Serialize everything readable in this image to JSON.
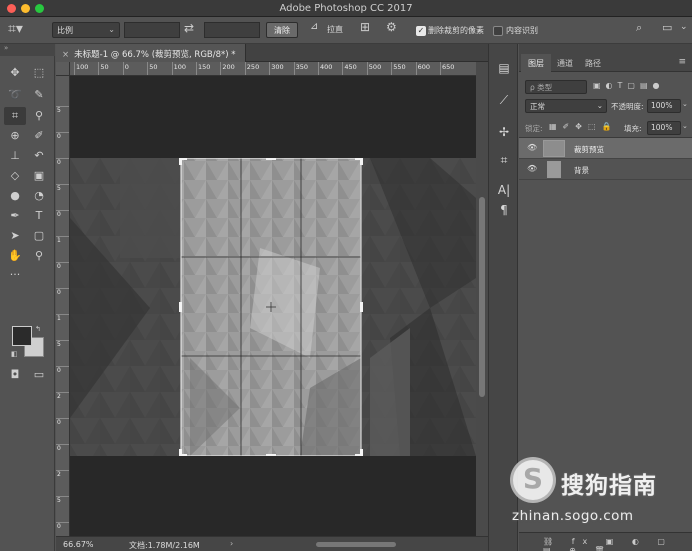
{
  "window": {
    "title": "Adobe Photoshop CC 2017"
  },
  "options_bar": {
    "ratio_select": "比例",
    "clear_button": "清除",
    "straighten_label": "拉直",
    "delete_cropped_label": "删除裁剪的像素",
    "delete_cropped_checked": true,
    "content_aware_label": "内容识别",
    "content_aware_checked": false
  },
  "document": {
    "tab_label": "未标题-1 @ 66.7% (裁剪预览, RGB/8*) *",
    "ruler_ticks": [
      "100",
      "50",
      "0",
      "50",
      "100",
      "150",
      "200",
      "250",
      "300",
      "350",
      "400",
      "450",
      "500",
      "550",
      "600",
      "650"
    ],
    "vruler_ticks": [
      "5",
      "0",
      "0",
      "5",
      "0",
      "1",
      "0",
      "0",
      "1",
      "5",
      "0",
      "2",
      "0",
      "0",
      "2",
      "5",
      "0"
    ]
  },
  "status_bar": {
    "zoom": "66.67%",
    "doc_info": "文档:1.78M/2.16M",
    "arrow": "›"
  },
  "layers_panel": {
    "tabs": [
      {
        "label": "图层",
        "active": true
      },
      {
        "label": "通道",
        "active": false
      },
      {
        "label": "路径",
        "active": false
      }
    ],
    "filter_placeholder": "ρ 类型",
    "blend_mode": "正常",
    "opacity_label": "不透明度:",
    "opacity_value": "100%",
    "lock_label": "锁定:",
    "fill_label": "填充:",
    "fill_value": "100%",
    "layers": [
      {
        "name": "裁剪预览",
        "selected": true,
        "visible": true
      },
      {
        "name": "背景",
        "selected": false,
        "visible": true
      }
    ]
  },
  "watermark": {
    "title": "搜狗指南",
    "url": "zhinan.sogo.com"
  },
  "colors": {
    "foreground": "#2b2b2b",
    "background": "#cfcfcf",
    "ui_dark": "#535353",
    "canvas_bg": "#282828"
  }
}
